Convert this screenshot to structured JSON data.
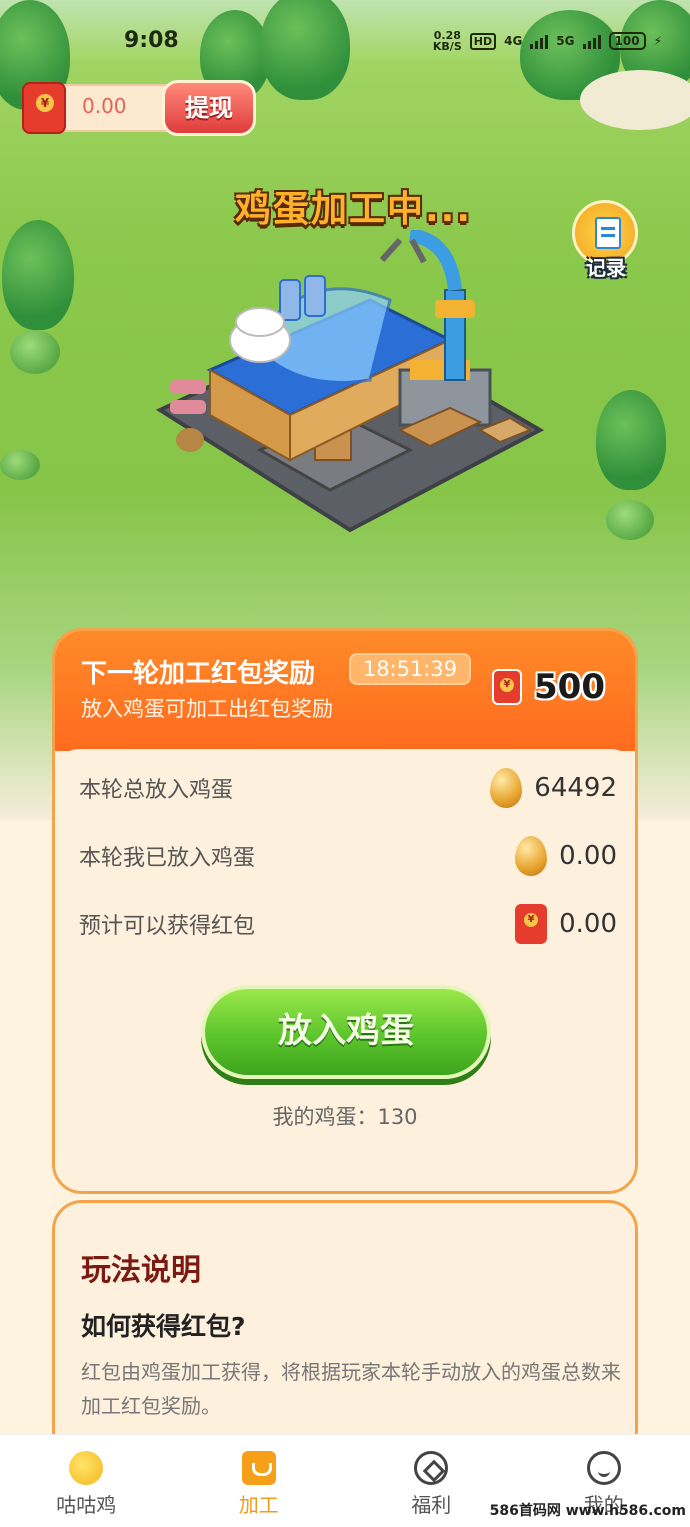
{
  "status_bar": {
    "time": "9:08",
    "net_speed_value": "0.28",
    "net_speed_unit": "KB/S",
    "hd": "HD",
    "net_4g": "4G",
    "net_5g": "5G",
    "battery": "100"
  },
  "wallet": {
    "amount": "0.00",
    "withdraw_label": "提现"
  },
  "scene": {
    "processing_title": "鸡蛋加工中...",
    "record_label": "记录"
  },
  "round": {
    "title": "下一轮加工红包奖励",
    "timer": "18:51:39",
    "subtitle": "放入鸡蛋可加工出红包奖励",
    "reward": "500"
  },
  "stats": [
    {
      "label": "本轮总放入鸡蛋",
      "value": "64492",
      "icon": "egg-icon"
    },
    {
      "label": "本轮我已放入鸡蛋",
      "value": "0.00",
      "icon": "egg-icon"
    },
    {
      "label": "预计可以获得红包",
      "value": "0.00",
      "icon": "red-envelope-icon"
    }
  ],
  "action": {
    "put_eggs_label": "放入鸡蛋",
    "my_eggs": "我的鸡蛋：130"
  },
  "rules": {
    "title": "玩法说明",
    "question": "如何获得红包?",
    "answer": "红包由鸡蛋加工获得，将根据玩家本轮手动放入的鸡蛋总数来加工红包奖励。"
  },
  "nav": [
    {
      "label": "咕咕鸡",
      "icon": "chick-icon"
    },
    {
      "label": "加工",
      "icon": "process-icon"
    },
    {
      "label": "福利",
      "icon": "welfare-icon"
    },
    {
      "label": "我的",
      "icon": "smile-icon"
    }
  ],
  "watermark": "586首码网 www.h586.com",
  "colors": {
    "accent_orange": "#ff6b1f",
    "button_green": "#5cc52c",
    "nav_active": "#f29a1b"
  }
}
